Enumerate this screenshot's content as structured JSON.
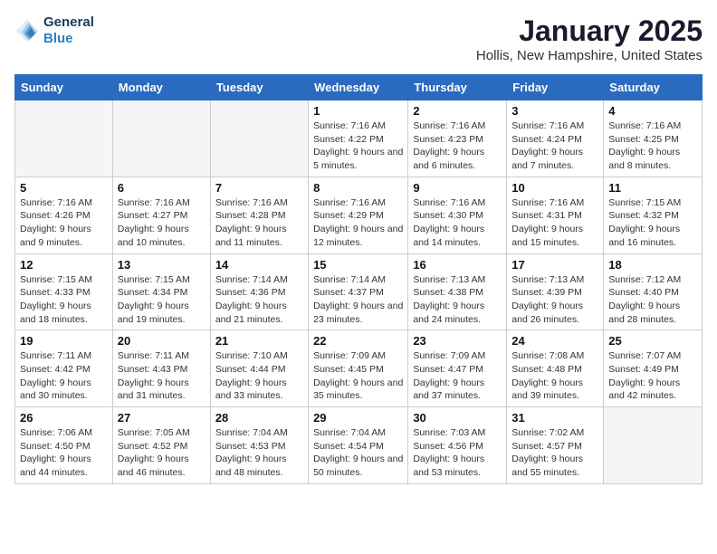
{
  "header": {
    "logo_line1": "General",
    "logo_line2": "Blue",
    "month": "January 2025",
    "location": "Hollis, New Hampshire, United States"
  },
  "weekdays": [
    "Sunday",
    "Monday",
    "Tuesday",
    "Wednesday",
    "Thursday",
    "Friday",
    "Saturday"
  ],
  "weeks": [
    [
      {
        "day": "",
        "info": ""
      },
      {
        "day": "",
        "info": ""
      },
      {
        "day": "",
        "info": ""
      },
      {
        "day": "1",
        "info": "Sunrise: 7:16 AM\nSunset: 4:22 PM\nDaylight: 9 hours and 5 minutes."
      },
      {
        "day": "2",
        "info": "Sunrise: 7:16 AM\nSunset: 4:23 PM\nDaylight: 9 hours and 6 minutes."
      },
      {
        "day": "3",
        "info": "Sunrise: 7:16 AM\nSunset: 4:24 PM\nDaylight: 9 hours and 7 minutes."
      },
      {
        "day": "4",
        "info": "Sunrise: 7:16 AM\nSunset: 4:25 PM\nDaylight: 9 hours and 8 minutes."
      }
    ],
    [
      {
        "day": "5",
        "info": "Sunrise: 7:16 AM\nSunset: 4:26 PM\nDaylight: 9 hours and 9 minutes."
      },
      {
        "day": "6",
        "info": "Sunrise: 7:16 AM\nSunset: 4:27 PM\nDaylight: 9 hours and 10 minutes."
      },
      {
        "day": "7",
        "info": "Sunrise: 7:16 AM\nSunset: 4:28 PM\nDaylight: 9 hours and 11 minutes."
      },
      {
        "day": "8",
        "info": "Sunrise: 7:16 AM\nSunset: 4:29 PM\nDaylight: 9 hours and 12 minutes."
      },
      {
        "day": "9",
        "info": "Sunrise: 7:16 AM\nSunset: 4:30 PM\nDaylight: 9 hours and 14 minutes."
      },
      {
        "day": "10",
        "info": "Sunrise: 7:16 AM\nSunset: 4:31 PM\nDaylight: 9 hours and 15 minutes."
      },
      {
        "day": "11",
        "info": "Sunrise: 7:15 AM\nSunset: 4:32 PM\nDaylight: 9 hours and 16 minutes."
      }
    ],
    [
      {
        "day": "12",
        "info": "Sunrise: 7:15 AM\nSunset: 4:33 PM\nDaylight: 9 hours and 18 minutes."
      },
      {
        "day": "13",
        "info": "Sunrise: 7:15 AM\nSunset: 4:34 PM\nDaylight: 9 hours and 19 minutes."
      },
      {
        "day": "14",
        "info": "Sunrise: 7:14 AM\nSunset: 4:36 PM\nDaylight: 9 hours and 21 minutes."
      },
      {
        "day": "15",
        "info": "Sunrise: 7:14 AM\nSunset: 4:37 PM\nDaylight: 9 hours and 23 minutes."
      },
      {
        "day": "16",
        "info": "Sunrise: 7:13 AM\nSunset: 4:38 PM\nDaylight: 9 hours and 24 minutes."
      },
      {
        "day": "17",
        "info": "Sunrise: 7:13 AM\nSunset: 4:39 PM\nDaylight: 9 hours and 26 minutes."
      },
      {
        "day": "18",
        "info": "Sunrise: 7:12 AM\nSunset: 4:40 PM\nDaylight: 9 hours and 28 minutes."
      }
    ],
    [
      {
        "day": "19",
        "info": "Sunrise: 7:11 AM\nSunset: 4:42 PM\nDaylight: 9 hours and 30 minutes."
      },
      {
        "day": "20",
        "info": "Sunrise: 7:11 AM\nSunset: 4:43 PM\nDaylight: 9 hours and 31 minutes."
      },
      {
        "day": "21",
        "info": "Sunrise: 7:10 AM\nSunset: 4:44 PM\nDaylight: 9 hours and 33 minutes."
      },
      {
        "day": "22",
        "info": "Sunrise: 7:09 AM\nSunset: 4:45 PM\nDaylight: 9 hours and 35 minutes."
      },
      {
        "day": "23",
        "info": "Sunrise: 7:09 AM\nSunset: 4:47 PM\nDaylight: 9 hours and 37 minutes."
      },
      {
        "day": "24",
        "info": "Sunrise: 7:08 AM\nSunset: 4:48 PM\nDaylight: 9 hours and 39 minutes."
      },
      {
        "day": "25",
        "info": "Sunrise: 7:07 AM\nSunset: 4:49 PM\nDaylight: 9 hours and 42 minutes."
      }
    ],
    [
      {
        "day": "26",
        "info": "Sunrise: 7:06 AM\nSunset: 4:50 PM\nDaylight: 9 hours and 44 minutes."
      },
      {
        "day": "27",
        "info": "Sunrise: 7:05 AM\nSunset: 4:52 PM\nDaylight: 9 hours and 46 minutes."
      },
      {
        "day": "28",
        "info": "Sunrise: 7:04 AM\nSunset: 4:53 PM\nDaylight: 9 hours and 48 minutes."
      },
      {
        "day": "29",
        "info": "Sunrise: 7:04 AM\nSunset: 4:54 PM\nDaylight: 9 hours and 50 minutes."
      },
      {
        "day": "30",
        "info": "Sunrise: 7:03 AM\nSunset: 4:56 PM\nDaylight: 9 hours and 53 minutes."
      },
      {
        "day": "31",
        "info": "Sunrise: 7:02 AM\nSunset: 4:57 PM\nDaylight: 9 hours and 55 minutes."
      },
      {
        "day": "",
        "info": ""
      }
    ]
  ]
}
